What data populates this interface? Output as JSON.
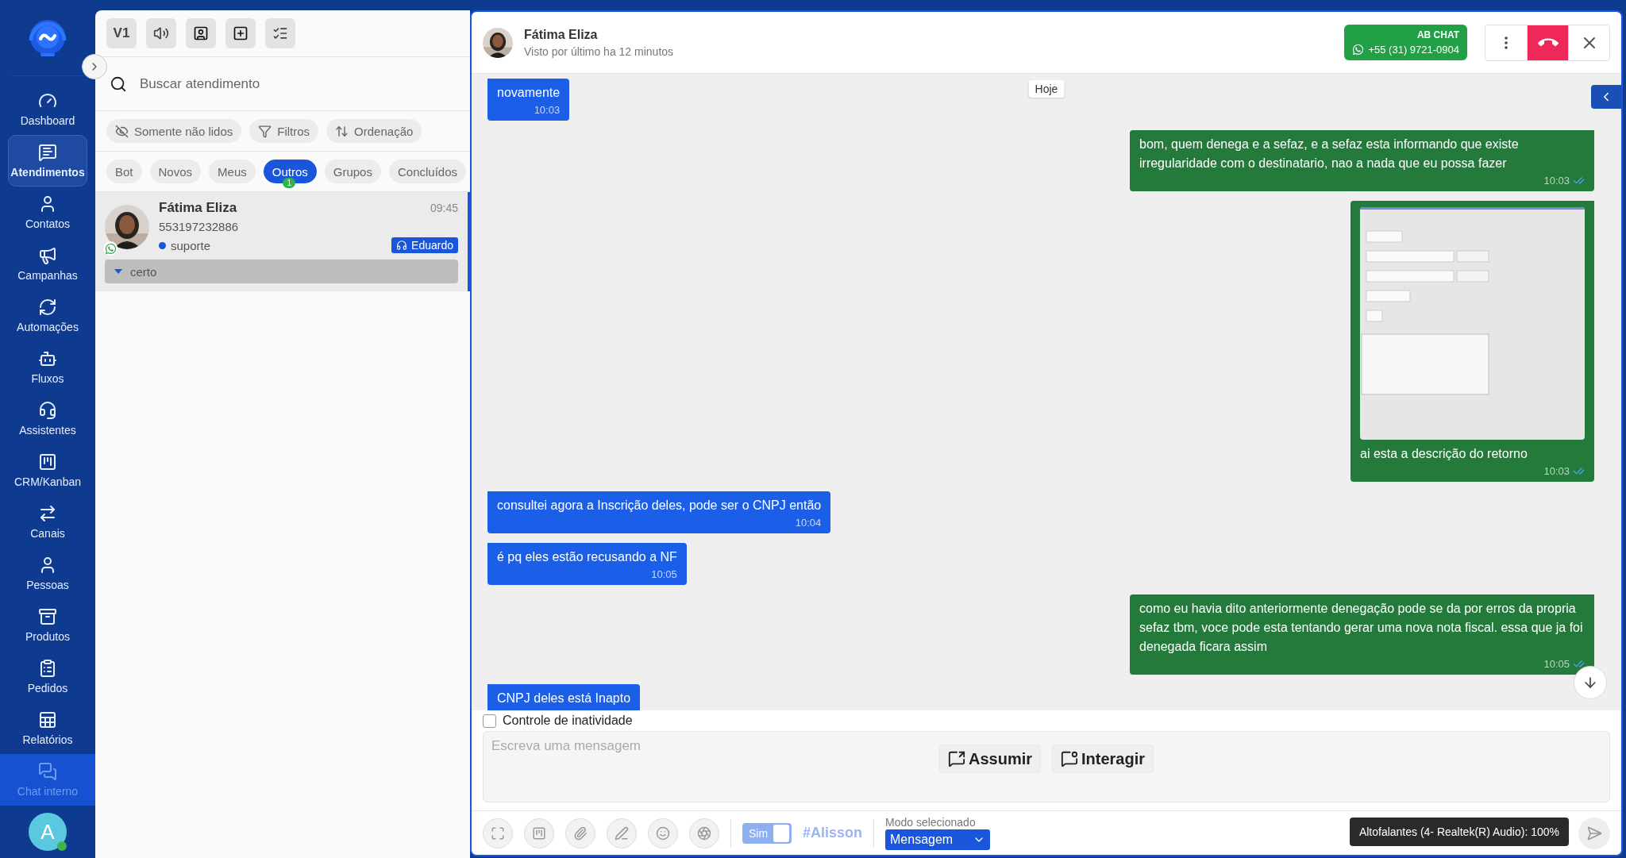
{
  "sidebar": {
    "items": [
      {
        "label": "Dashboard",
        "kind": "nav",
        "selected": false
      },
      {
        "label": "Atendimentos",
        "kind": "nav",
        "selected": true
      },
      {
        "label": "Contatos",
        "kind": "nav",
        "selected": false
      },
      {
        "label": "Campanhas",
        "kind": "nav",
        "selected": false
      },
      {
        "label": "Automações",
        "kind": "nav",
        "selected": false
      },
      {
        "label": "Fluxos",
        "kind": "nav",
        "selected": false
      },
      {
        "label": "Assistentes",
        "kind": "nav",
        "selected": false
      },
      {
        "label": "CRM/Kanban",
        "kind": "nav",
        "selected": false
      },
      {
        "label": "Canais",
        "kind": "nav",
        "selected": false
      },
      {
        "label": "Pessoas",
        "kind": "nav",
        "selected": false
      },
      {
        "label": "Produtos",
        "kind": "nav",
        "selected": false
      },
      {
        "label": "Pedidos",
        "kind": "nav",
        "selected": false
      },
      {
        "label": "Relatórios",
        "kind": "nav",
        "selected": false
      },
      {
        "label": "Chat interno",
        "kind": "pinned",
        "selected": false
      }
    ],
    "user": {
      "initial": "A",
      "online": true
    }
  },
  "list_panel": {
    "version": "V1",
    "search": {
      "placeholder": "Buscar atendimento"
    },
    "filters": [
      "Somente não lidos",
      "Filtros",
      "Ordenação"
    ],
    "tabs": [
      {
        "label": "Bot",
        "selected": false
      },
      {
        "label": "Novos",
        "selected": false
      },
      {
        "label": "Meus",
        "selected": false
      },
      {
        "label": "Outros",
        "selected": true,
        "badge": "1"
      },
      {
        "label": "Grupos",
        "selected": false
      },
      {
        "label": "Concluídos",
        "selected": false
      }
    ],
    "conversations": [
      {
        "name": "Fátima Eliza",
        "phone": "553197232886",
        "time": "09:45",
        "queue": "suporte",
        "color": "#1a56db",
        "agent": "Eduardo",
        "last_message": "certo",
        "selected": true
      }
    ]
  },
  "chat": {
    "contact": {
      "name": "Fátima Eliza",
      "status": "Visto por último ha 12 minutos"
    },
    "connection": {
      "name": "AB CHAT",
      "phone": "+55 (31) 9721-0904"
    },
    "date_label": "Hoje",
    "messages": [
      {
        "kind": "in",
        "text": "novamente",
        "time": "10:03"
      },
      {
        "kind": "out",
        "text": "bom, quem denega e a sefaz, e a sefaz esta informando que existe irregularidade com o destinatario, nao a nada que eu possa fazer",
        "time": "10:03",
        "read": true
      },
      {
        "kind": "out",
        "text": "ai esta a descrição do retorno",
        "time": "10:03",
        "read": true
      },
      {
        "kind": "in",
        "text": "consultei agora a Inscrição deles, pode ser o CNPJ então",
        "time": "10:04"
      },
      {
        "kind": "in",
        "text": "é pq eles estão recusando a NF",
        "time": "10:05"
      },
      {
        "kind": "out",
        "text": "como eu havia dito anteriormente denegação pode se da por erros da propria sefaz tbm, voce pode esta tentando gerar uma nova nota fiscal. essa que ja foi denegada ficara assim",
        "time": "10:05",
        "read": true
      },
      {
        "kind": "in",
        "text": "CNPJ deles está Inapto"
      }
    ],
    "inactivity_control": {
      "label": "Controle de inatividade",
      "checked": false
    },
    "composer": {
      "placeholder": "Escreva uma mensagem",
      "actions": [
        "Assumir",
        "Interagir"
      ]
    },
    "signature": {
      "label": "Sim",
      "on": true
    },
    "agent_tag": "#Alisson",
    "mode": {
      "label": "Modo selecionado",
      "value": "Mensagem"
    },
    "tooltip": "Altofalantes (4- Realtek(R) Audio): 100%"
  }
}
